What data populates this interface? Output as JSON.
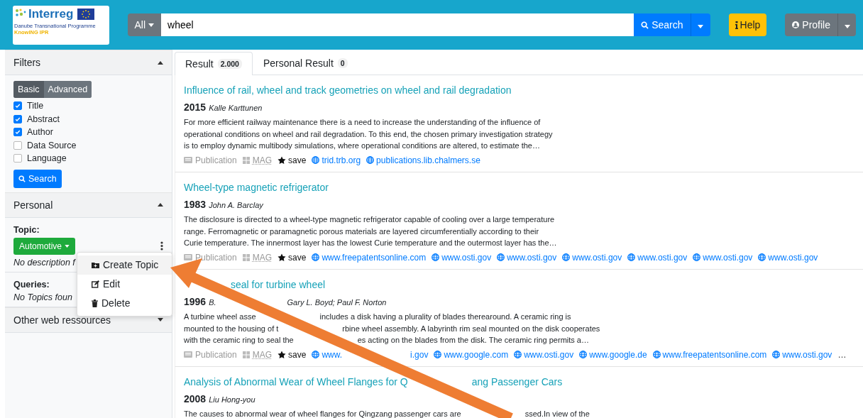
{
  "header": {
    "logo": {
      "title": "Interreg",
      "subtitle": "Danube Transnational Programme",
      "tag": "KnowING IPR"
    },
    "scope": "All",
    "query": "wheel",
    "search_button": "Search",
    "help_button": "Help",
    "profile_button": "Profile"
  },
  "sidebar": {
    "filters": {
      "title": "Filters",
      "expanded": true,
      "modes": [
        {
          "label": "Basic",
          "selected": true
        },
        {
          "label": "Advanced",
          "selected": false
        }
      ],
      "fields": [
        {
          "label": "Title",
          "checked": true
        },
        {
          "label": "Abstract",
          "checked": true
        },
        {
          "label": "Author",
          "checked": true
        },
        {
          "label": "Data Source",
          "checked": false
        },
        {
          "label": "Language",
          "checked": false
        }
      ],
      "button": "Search"
    },
    "personal": {
      "title": "Personal",
      "expanded": true,
      "topic_label": "Topic:",
      "topic": "Automotive",
      "description": "No description f",
      "queries_label": "Queries:",
      "queries_empty": "No Topics foun",
      "menu": [
        {
          "kind": "create",
          "label": "Create Topic",
          "selected": true
        },
        {
          "kind": "edit",
          "label": "Edit",
          "selected": false
        },
        {
          "kind": "delete",
          "label": "Delete",
          "selected": false
        }
      ]
    },
    "other": {
      "title": "Other web ressources",
      "expanded": false
    }
  },
  "tabs": [
    {
      "label": "Result",
      "count": "2.000",
      "selected": true
    },
    {
      "label": "Personal Result",
      "count": "0",
      "selected": false
    }
  ],
  "results": [
    {
      "title": [
        "Influence of rail, wheel and track geometries on wheel and rail degradation"
      ],
      "year": "2015",
      "authors": [
        "Kalle Karttunen"
      ],
      "abstract": [
        [
          "For more efficient railway maintenance there is a need to increase the understanding of the influence of"
        ],
        [
          "operational conditions on wheel and rail degradation. To this end, the chosen primary investigation strategy"
        ],
        [
          "is to employ dynamic multibody simulations, where operational conditions are altered, to estimate the…"
        ]
      ],
      "type": "Publication",
      "source": "MAG",
      "save": "save",
      "links": [
        [
          "trid.trb.org"
        ],
        [
          "publications.lib.chalmers.se"
        ]
      ]
    },
    {
      "title": [
        "Wheel-type magnetic refrigerator"
      ],
      "year": "1983",
      "authors": [
        "John A. Barclay"
      ],
      "abstract": [
        [
          "The disclosure is directed to a wheel-type magnetic refrigerator capable of cooling over a large temperature"
        ],
        [
          "range. Ferromagnetic or paramagnetic porous materials are layered circumferentially according to their"
        ],
        [
          "Curie temperature. The innermost layer has the lowest Curie temperature and the outermost layer has the…"
        ]
      ],
      "type": "Publication",
      "source": "MAG",
      "save": "save",
      "links": [
        [
          "www.freepatentsonline.com"
        ],
        [
          "www.osti.gov"
        ],
        [
          "www.osti.gov"
        ],
        [
          "www.osti.gov"
        ],
        [
          "www.osti.gov"
        ],
        [
          "www.osti.gov"
        ],
        [
          "www.osti.gov"
        ]
      ]
    },
    {
      "title_start_hidden": true,
      "title": [
        "seal for turbine wheel"
      ],
      "year": "1996",
      "authors": [
        "B.",
        "Gary L. Boyd; Paul F. Norton"
      ],
      "abstract": [
        [
          "A turbine wheel asse",
          "includes a disk having a plurality of blades therearound. A ceramic ring is"
        ],
        [
          "mounted to the housing of t",
          "rbine wheel assembly. A labyrinth rim seal mounted on the disk cooperates"
        ],
        [
          "with the ceramic ring to seal the",
          "es acting on the blades from the disk. The ceramic ring permits a…"
        ]
      ],
      "type": "Publication",
      "source": "MAG",
      "save": "save",
      "links": [
        [
          "www.",
          "i.gov"
        ],
        [
          "www.google.com"
        ],
        [
          "www.osti.gov"
        ],
        [
          "www.google.de"
        ],
        [
          "www.freepatentsonline.com"
        ],
        [
          "www.osti.gov"
        ]
      ],
      "more": "…"
    },
    {
      "title": [
        "Analysis of Abnormal Wear of Wheel Flanges for Q",
        "ang Passenger Cars"
      ],
      "year": "2008",
      "authors": [
        "Liu Hong-you"
      ],
      "abstract": [
        [
          "The causes to abnormal wear of wheel flanges for Qingzang passenger cars are",
          "ssed.In view of the"
        ]
      ]
    }
  ]
}
